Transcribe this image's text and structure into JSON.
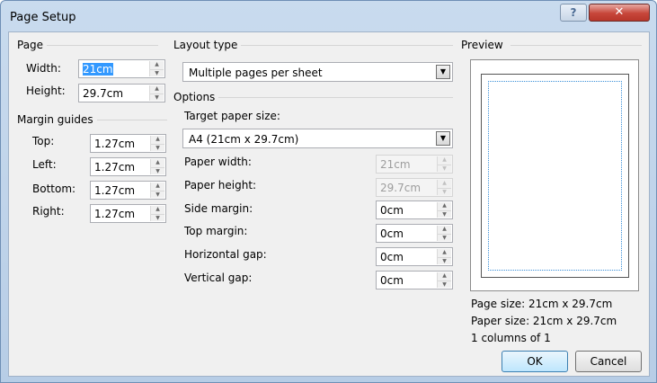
{
  "window": {
    "title": "Page Setup",
    "help_label": "?",
    "close_label": "✕"
  },
  "page": {
    "group_label": "Page",
    "width_label": "Width:",
    "width_value": "21cm",
    "height_label": "Height:",
    "height_value": "29.7cm"
  },
  "margins": {
    "group_label": "Margin guides",
    "top_label": "Top:",
    "top_value": "1.27cm",
    "left_label": "Left:",
    "left_value": "1.27cm",
    "bottom_label": "Bottom:",
    "bottom_value": "1.27cm",
    "right_label": "Right:",
    "right_value": "1.27cm"
  },
  "layout": {
    "group_label": "Layout type",
    "selected": "Multiple pages per sheet"
  },
  "options": {
    "group_label": "Options",
    "target_label": "Target paper size:",
    "target_selected": "A4 (21cm x 29.7cm)",
    "paper_width_label": "Paper width:",
    "paper_width_value": "21cm",
    "paper_height_label": "Paper height:",
    "paper_height_value": "29.7cm",
    "side_margin_label": "Side margin:",
    "side_margin_value": "0cm",
    "top_margin_label": "Top margin:",
    "top_margin_value": "0cm",
    "horizontal_gap_label": "Horizontal gap:",
    "horizontal_gap_value": "0cm",
    "vertical_gap_label": "Vertical gap:",
    "vertical_gap_value": "0cm"
  },
  "preview": {
    "group_label": "Preview",
    "page_size": "Page size: 21cm x 29.7cm",
    "paper_size": "Paper size: 21cm x 29.7cm",
    "columns": "1 columns of 1"
  },
  "buttons": {
    "ok": "OK",
    "cancel": "Cancel"
  },
  "icons": {
    "spin_up": "arrow-up-icon",
    "spin_down": "arrow-down-icon",
    "dropdown": "chevron-down-icon"
  }
}
